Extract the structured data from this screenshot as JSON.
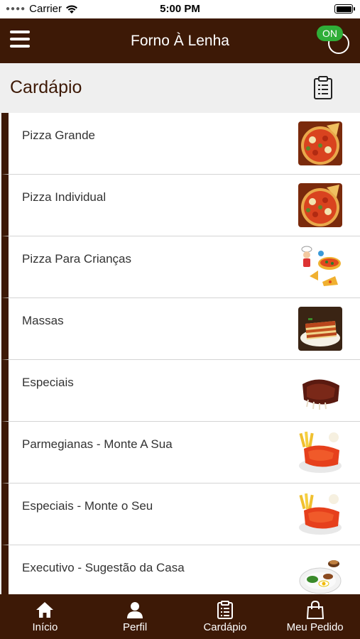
{
  "status_bar": {
    "carrier": "Carrier",
    "time": "5:00 PM"
  },
  "header": {
    "title": "Forno À Lenha",
    "status_badge": "ON"
  },
  "section": {
    "title": "Cardápio"
  },
  "menu_items": [
    {
      "label": "Pizza Grande",
      "icon": "pizza-photo"
    },
    {
      "label": "Pizza Individual",
      "icon": "pizza-photo"
    },
    {
      "label": "Pizza Para Crianças",
      "icon": "kids-pizza-illustration"
    },
    {
      "label": "Massas",
      "icon": "lasagna-photo"
    },
    {
      "label": "Especiais",
      "icon": "ribs-photo"
    },
    {
      "label": "Parmegianas - Monte A Sua",
      "icon": "parmegiana-photo"
    },
    {
      "label": "Especiais - Monte o Seu",
      "icon": "parmegiana-photo"
    },
    {
      "label": "Executivo - Sugestão da Casa",
      "icon": "plate-photo"
    }
  ],
  "tabs": [
    {
      "label": "Início",
      "icon": "home-icon"
    },
    {
      "label": "Perfil",
      "icon": "user-icon"
    },
    {
      "label": "Cardápio",
      "icon": "clipboard-icon"
    },
    {
      "label": "Meu Pedido",
      "icon": "shopping-bag-icon"
    }
  ],
  "colors": {
    "brand": "#3d1906",
    "online": "#2fae38",
    "background": "#efefef"
  }
}
